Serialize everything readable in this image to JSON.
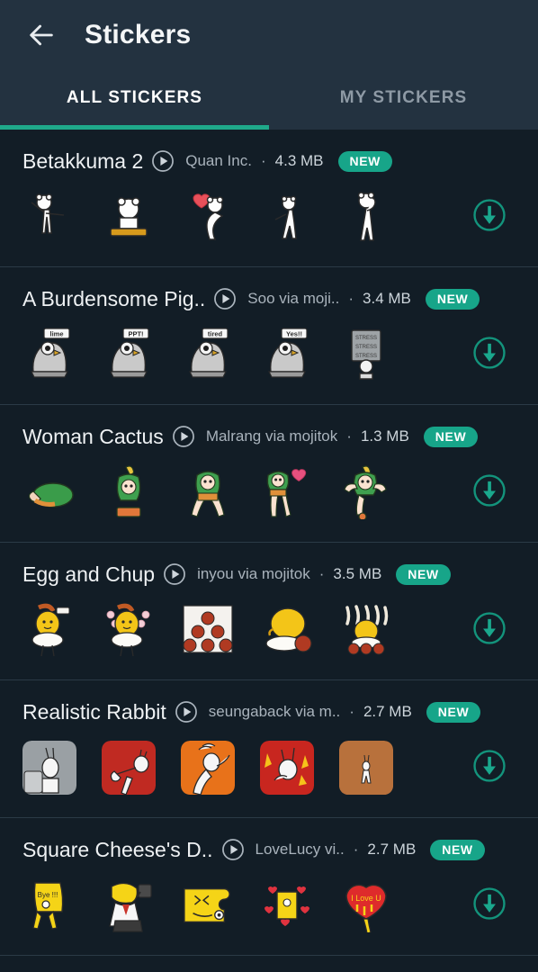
{
  "appbar": {
    "back_icon": "arrow-left-icon",
    "title": "Stickers"
  },
  "tabs": [
    {
      "label": "ALL STICKERS",
      "active": true
    },
    {
      "label": "MY STICKERS",
      "active": false
    }
  ],
  "colors": {
    "accent_teal": "#1fa98a",
    "badge_teal": "#17a589",
    "header_bg": "#233240",
    "body_bg": "#121d26",
    "divider": "#2b3a46",
    "title_text": "#eef1f3",
    "secondary_text": "#a9b3bc"
  },
  "common": {
    "play_icon": "play-circle-icon",
    "download_icon": "download-circle-icon",
    "separator": "·",
    "new_label": "NEW"
  },
  "packs": [
    {
      "title": "Betakkuma 2",
      "author": "Quan Inc.",
      "size": "4.3 MB",
      "badge": "NEW",
      "sticker_count": 5
    },
    {
      "title": "A Burdensome Pig..",
      "author": "Soo via moji..",
      "size": "3.4 MB",
      "badge": "NEW",
      "sticker_count": 5
    },
    {
      "title": "Woman Cactus",
      "author": "Malrang via mojitok",
      "size": "1.3 MB",
      "badge": "NEW",
      "sticker_count": 5
    },
    {
      "title": "Egg and Chup",
      "author": "inyou via mojitok",
      "size": "3.5 MB",
      "badge": "NEW",
      "sticker_count": 5
    },
    {
      "title": "Realistic Rabbit",
      "author": "seungaback via m..",
      "size": "2.7 MB",
      "badge": "NEW",
      "sticker_count": 5
    },
    {
      "title": "Square Cheese's D..",
      "author": "LoveLucy vi..",
      "size": "2.7 MB",
      "badge": "NEW",
      "sticker_count": 5
    }
  ]
}
